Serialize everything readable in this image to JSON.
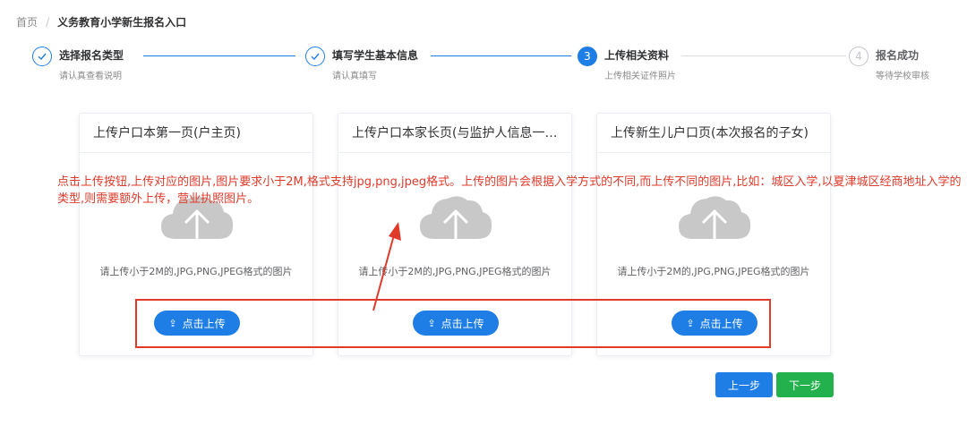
{
  "breadcrumb": {
    "home": "首页",
    "separator": "/",
    "current": "义务教育小学新生报名入口"
  },
  "steps": [
    {
      "title": "选择报名类型",
      "desc": "请认真查看说明",
      "status": "finish",
      "icon": "check-icon"
    },
    {
      "title": "填写学生基本信息",
      "desc": "请认真填写",
      "status": "finish",
      "icon": "check-icon"
    },
    {
      "title": "上传相关资料",
      "desc": "上传相关证件照片",
      "status": "process",
      "number": "3"
    },
    {
      "title": "报名成功",
      "desc": "等待学校审核",
      "status": "wait",
      "number": "4"
    }
  ],
  "cards": [
    {
      "title": "上传户口本第一页(户主页)",
      "hint": "请上传小于2M的,JPG,PNG,JPEG格式的图片",
      "button": "点击上传",
      "icon": "upload-cloud-icon"
    },
    {
      "title": "上传户口本家长页(与监护人信息一…",
      "hint": "请上传小于2M的,JPG,PNG,JPEG格式的图片",
      "button": "点击上传",
      "icon": "upload-cloud-icon"
    },
    {
      "title": "上传新生儿户口页(本次报名的子女)",
      "hint": "请上传小于2M的,JPG,PNG,JPEG格式的图片",
      "button": "点击上传",
      "icon": "upload-cloud-icon"
    }
  ],
  "annotation": {
    "text": "点击上传按钮,上传对应的图片,图片要求小于2M,格式支持jpg,png,jpeg格式。上传的图片会根据入学方式的不同,而上传不同的图片,比如：城区入学,以夏津城区经商地址入学的类型,则需要额外上传，营业执照图片。"
  },
  "footer": {
    "prev_label": "上一步",
    "next_label": "下一步"
  },
  "colors": {
    "primary": "#1f7ee6",
    "success": "#22b14c",
    "annotation_red": "#e03a2a",
    "cloud_gray": "#c8c8c8"
  }
}
